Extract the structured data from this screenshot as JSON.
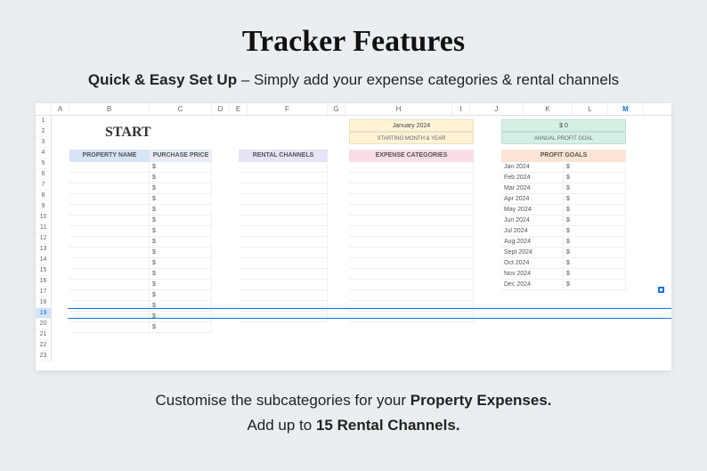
{
  "title": "Tracker Features",
  "subtitle_bold": "Quick & Easy Set Up",
  "subtitle_rest": " – Simply add your expense categories & rental channels",
  "sheet": {
    "columns": [
      "A",
      "B",
      "C",
      "D",
      "E",
      "F",
      "G",
      "H",
      "I",
      "J",
      "K",
      "L",
      "M"
    ],
    "rows": [
      "1",
      "2",
      "3",
      "4",
      "5",
      "6",
      "7",
      "8",
      "9",
      "10",
      "11",
      "12",
      "13",
      "14",
      "15",
      "16",
      "17",
      "18",
      "19",
      "20",
      "21",
      "22",
      "23"
    ],
    "active_row": "19",
    "start_label": "START",
    "month_header": "January 2024",
    "month_sub": "STARTING MONTH & YEAR",
    "goal_header": "$ 0",
    "goal_sub": "ANNUAL PROFIT GOAL",
    "col_property": "PROPERTY NAME",
    "col_purchase": "PURCHASE PRICE",
    "col_rental": "RENTAL CHANNELS",
    "col_expense": "EXPENSE CATEGORIES",
    "col_profit": "PROFIT GOALS",
    "profit_months": [
      "Jan 2024",
      "Feb 2024",
      "Mar 2024",
      "Apr 2024",
      "May 2024",
      "Jun 2024",
      "Jul 2024",
      "Aug 2024",
      "Sept 2024",
      "Oct 2024",
      "Nov 2024",
      "Dec 2024"
    ],
    "dollar": "$"
  },
  "footer1_a": "Customise the subcategories for your ",
  "footer1_b": "Property Expenses.",
  "footer2_a": "Add up to ",
  "footer2_b": "15 Rental Channels."
}
